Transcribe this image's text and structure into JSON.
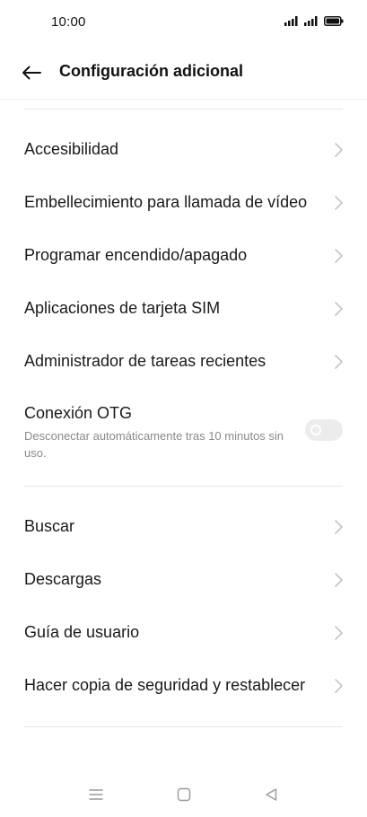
{
  "status_bar": {
    "time": "10:00"
  },
  "header": {
    "title": "Configuración adicional"
  },
  "group1": {
    "items": [
      {
        "label": "Accesibilidad"
      },
      {
        "label": "Embellecimiento para llamada de vídeo"
      },
      {
        "label": "Programar encendido/apagado"
      },
      {
        "label": "Aplicaciones de tarjeta SIM"
      },
      {
        "label": "Administrador de tareas recientes"
      }
    ],
    "otg": {
      "title": "Conexión OTG",
      "subtitle": "Desconectar automáticamente tras 10 minutos sin uso.",
      "enabled": false
    }
  },
  "group2": {
    "items": [
      {
        "label": "Buscar"
      },
      {
        "label": "Descargas"
      },
      {
        "label": "Guía de usuario"
      },
      {
        "label": "Hacer copia de seguridad y restablecer"
      }
    ]
  },
  "icons": {
    "back": "arrow-left-icon",
    "chevron": "chevron-right-icon",
    "nav_menu": "menu-icon",
    "nav_home": "home-square-icon",
    "nav_back": "back-triangle-icon"
  },
  "colors": {
    "text": "#1a1a1a",
    "subtext": "#8a8a8a",
    "divider": "#e6e6e6",
    "chevron": "#c4c4c4",
    "toggle_off": "#ececec"
  }
}
